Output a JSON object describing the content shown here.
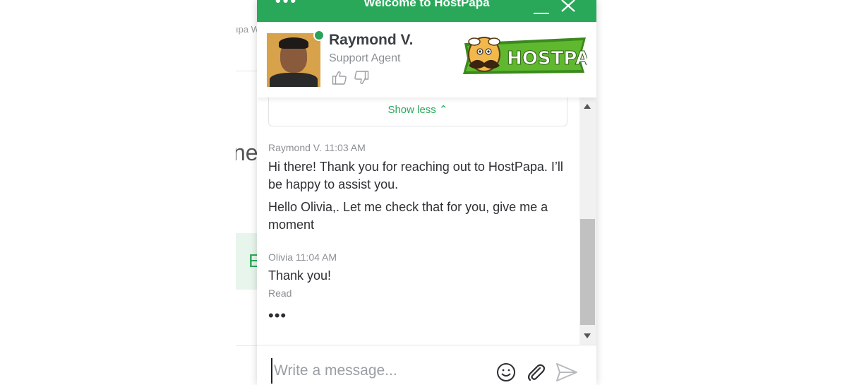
{
  "background": {
    "breadcrumb": "ıpa W",
    "heading_fragment": "ne.",
    "green_box_letter": "E"
  },
  "widget": {
    "title": "Welcome to HostPapa",
    "menu_glyph": "•••",
    "accent_color": "#2aa85a"
  },
  "agent": {
    "name": "Raymond V.",
    "role": "Support Agent",
    "status": "online",
    "status_color": "#29a35a"
  },
  "logo": {
    "text": "HOSTPAPA"
  },
  "conversation": {
    "show_less_label": "Show less ⌃",
    "messages": [
      {
        "meta": "Raymond V. 11:03 AM",
        "lines": [
          "Hi there! Thank you for reaching out to HostPapa. I’ll be happy to assist you.",
          "Hello Olivia,. Let me check that for you, give me a moment"
        ]
      },
      {
        "meta": "Olivia 11:04 AM",
        "lines": [
          "Thank you!"
        ],
        "receipt": "Read"
      }
    ],
    "typing_indicator": "•••"
  },
  "composer": {
    "placeholder": "Write a message...",
    "value": "",
    "icons": [
      "emoji-icon",
      "paperclip-icon",
      "send-icon"
    ]
  }
}
